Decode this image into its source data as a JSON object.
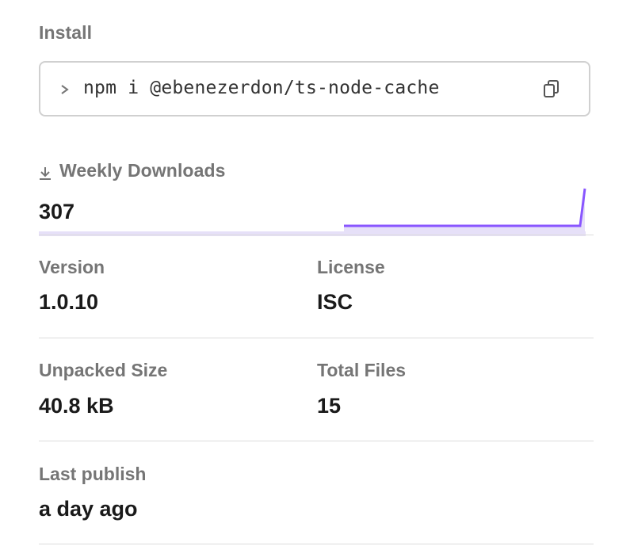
{
  "install": {
    "label": "Install",
    "command": "npm i @ebenezerdon/ts-node-cache",
    "prompt_icon": "chevron-right-icon",
    "copy_icon": "copy-icon"
  },
  "downloads": {
    "label": "Weekly Downloads",
    "icon": "download-icon",
    "value": "307",
    "accent": "#8956ff",
    "fill": "#e6e0f8"
  },
  "stats": {
    "version": {
      "label": "Version",
      "value": "1.0.10"
    },
    "license": {
      "label": "License",
      "value": "ISC"
    },
    "unpacked_size": {
      "label": "Unpacked Size",
      "value": "40.8 kB"
    },
    "total_files": {
      "label": "Total Files",
      "value": "15"
    },
    "last_publish": {
      "label": "Last publish",
      "value": "a day ago"
    }
  }
}
